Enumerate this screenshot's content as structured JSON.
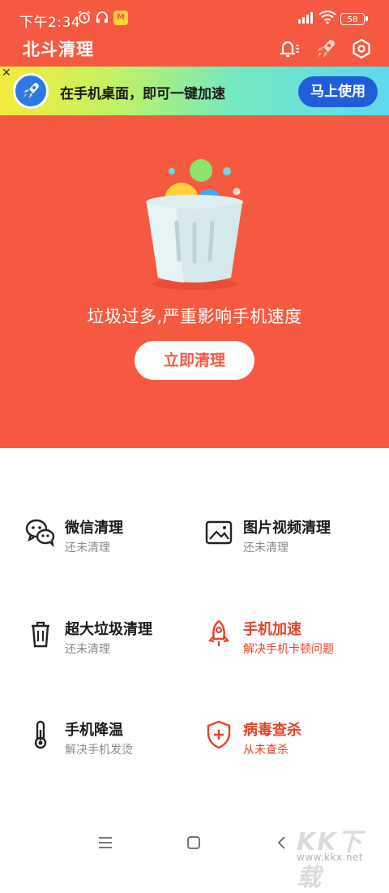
{
  "status_bar": {
    "time": "下午2:34",
    "badge": "M",
    "battery": "58"
  },
  "header": {
    "title": "北斗清理"
  },
  "banner": {
    "text": "在手机桌面，即可一键加速",
    "button": "马上使用"
  },
  "hero": {
    "message": "垃圾过多,严重影响手机速度",
    "button": "立即清理"
  },
  "features": [
    {
      "title": "微信清理",
      "subtitle": "还未清理",
      "icon": "wechat-icon"
    },
    {
      "title": "图片视频清理",
      "subtitle": "还未清理",
      "icon": "image-icon"
    },
    {
      "title": "超大垃圾清理",
      "subtitle": "还未清理",
      "icon": "trash-icon"
    },
    {
      "title": "手机加速",
      "subtitle": "解决手机卡顿问题",
      "icon": "rocket-icon"
    },
    {
      "title": "手机降温",
      "subtitle": "解决手机发烫",
      "icon": "thermometer-icon"
    },
    {
      "title": "病毒查杀",
      "subtitle": "从未查杀",
      "icon": "shield-icon"
    }
  ],
  "watermark": {
    "logo": "KK下载",
    "url": "www.kkx.net"
  },
  "colors": {
    "primary": "#f55a40",
    "accent": "#e5432a",
    "banner_button": "#1f5ed8"
  }
}
